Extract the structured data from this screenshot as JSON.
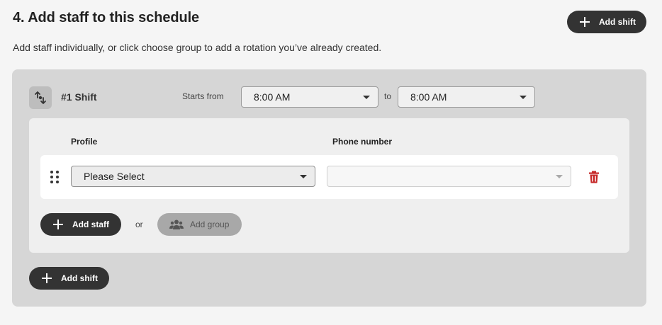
{
  "section": {
    "title": "4. Add staff to this schedule",
    "subtitle": "Add staff individually, or click choose group to add a rotation you’ve already created.",
    "add_shift_top_label": "Add shift"
  },
  "shift": {
    "label": "#1 Shift",
    "starts_from_label": "Starts from",
    "start_time": "8:00 AM",
    "to_label": "to",
    "end_time": "8:00 AM"
  },
  "staff_table": {
    "columns": [
      "Profile",
      "Phone number"
    ],
    "rows": [
      {
        "profile_value": "Please Select",
        "phone_value": ""
      }
    ]
  },
  "actions": {
    "add_staff_label": "Add staff",
    "or_label": "or",
    "add_group_label": "Add group",
    "add_shift_bottom_label": "Add shift"
  },
  "colors": {
    "dark_button": "#333333",
    "disabled_button": "#a8a8a8",
    "delete_icon": "#c62828",
    "panel_bg": "#d6d6d6"
  },
  "icons": [
    "plus-icon",
    "swap-icon",
    "drag-handle-icon",
    "chevron-down-icon",
    "trash-icon",
    "group-icon"
  ]
}
